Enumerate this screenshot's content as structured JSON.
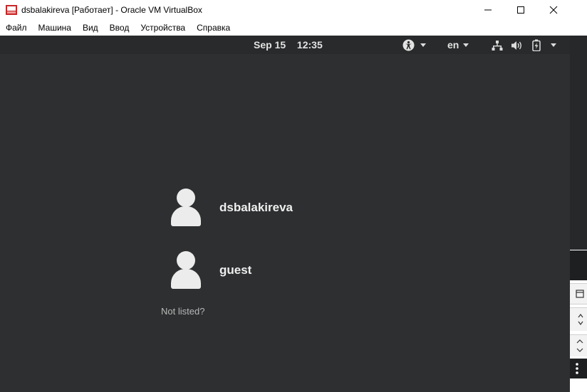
{
  "window": {
    "title": "dsbalakireva [Работает] - Oracle VM VirtualBox"
  },
  "menu": [
    {
      "label": "Файл"
    },
    {
      "label": "Машина"
    },
    {
      "label": "Вид"
    },
    {
      "label": "Ввод"
    },
    {
      "label": "Устройства"
    },
    {
      "label": "Справка"
    }
  ],
  "topbar": {
    "date": "Sep 15",
    "time": "12:35",
    "language": "en"
  },
  "users": [
    {
      "name": "dsbalakireva"
    },
    {
      "name": "guest"
    }
  ],
  "not_listed_label": "Not listed?",
  "colors": {
    "vm_background": "#2d2f30",
    "topbar": "#282a2b",
    "text": "#eeeeee",
    "accent_titlebar_icon": "#d32f2f"
  },
  "icons": [
    "virtualbox-icon",
    "minimize-icon",
    "maximize-icon",
    "close-icon",
    "accessibility-icon",
    "network-icon",
    "volume-icon",
    "battery-icon",
    "system-menu-icon",
    "user-avatar-icon"
  ]
}
